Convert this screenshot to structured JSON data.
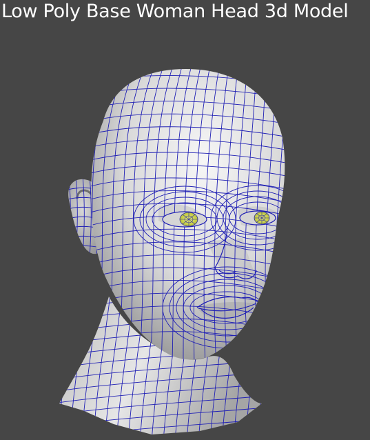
{
  "title": "Low Poly Base Woman Head 3d Model",
  "colors": {
    "background": "#464646",
    "title_text": "#ffffff",
    "skin_light": "#f1f1f1",
    "skin_mid": "#c9c9c9",
    "skin_shadow": "#8c8c8c",
    "wireframe": "#1f1fb4",
    "iris": "#e6ee5a"
  }
}
